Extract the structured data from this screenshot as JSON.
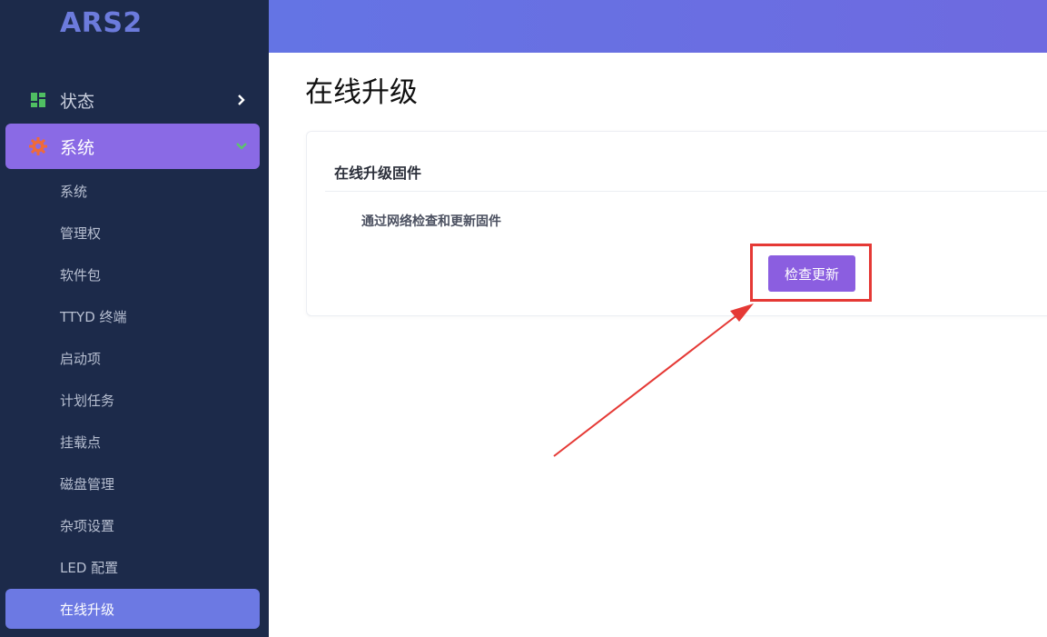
{
  "app": {
    "logo": "ARS2"
  },
  "sidebar": {
    "status": {
      "label": "状态",
      "icon": "dashboard-icon"
    },
    "system": {
      "label": "系统",
      "icon": "gear-icon"
    },
    "items": [
      {
        "label": "系统"
      },
      {
        "label": "管理权"
      },
      {
        "label": "软件包"
      },
      {
        "label": "TTYD 终端"
      },
      {
        "label": "启动项"
      },
      {
        "label": "计划任务"
      },
      {
        "label": "挂载点"
      },
      {
        "label": "磁盘管理"
      },
      {
        "label": "杂项设置"
      },
      {
        "label": "LED 配置"
      },
      {
        "label": "在线升级",
        "active": true
      }
    ]
  },
  "main": {
    "title": "在线升级",
    "card": {
      "title": "在线升级固件",
      "description": "通过网络检查和更新固件",
      "button_label": "检查更新"
    }
  },
  "colors": {
    "sidebar_bg": "#1c2a4a",
    "accent_purple": "#8a6ae5",
    "active_item": "#6c79e3",
    "topbar": "#6474e4",
    "button": "#8b5ee0",
    "highlight": "#e53935"
  }
}
